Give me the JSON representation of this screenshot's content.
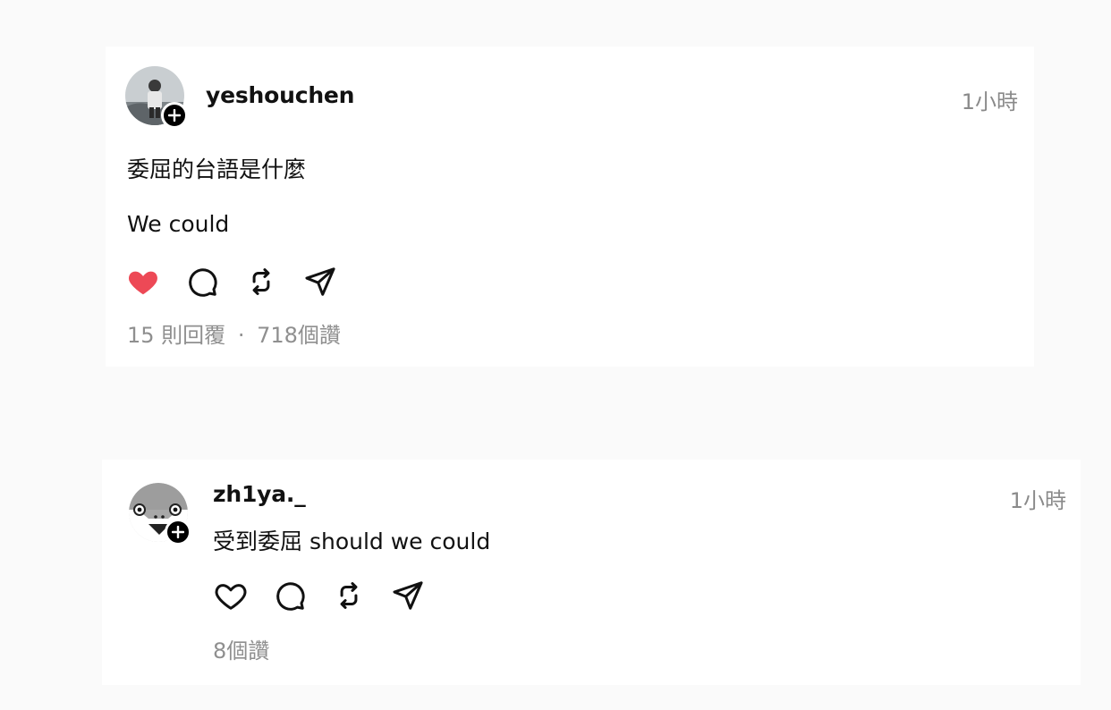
{
  "post": {
    "username": "yeshouchen",
    "time": "1小時",
    "lines": [
      "委屈的台語是什麼",
      "We could"
    ],
    "liked": true,
    "like_color": "#ed4956",
    "replies": "15 則回覆",
    "separator": "·",
    "likes": "718個讚"
  },
  "reply": {
    "username": "zh1ya._",
    "time": "1小時",
    "text": "受到委屈 should we could",
    "liked": false,
    "likes": "8個讚"
  },
  "icons": [
    "heart-icon",
    "comment-icon",
    "repost-icon",
    "share-icon",
    "plus-icon"
  ]
}
